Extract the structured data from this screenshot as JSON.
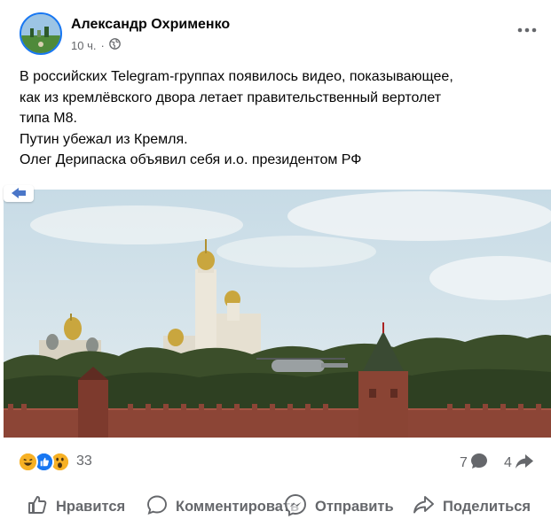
{
  "post": {
    "author": "Александр Охрименко",
    "time": "10 ч.",
    "separator": "·",
    "text_lines": [
      "В российских Telegram-группах появилось видео, показывающее,",
      "как из кремлёвского двора летает правительственный вертолет",
      "типа М8.",
      "Путин убежал из Кремля.",
      "Олег Дерипаска объявил себя и.о. президентом РФ"
    ],
    "image_alt_icon": "video-badge-icon"
  },
  "stats": {
    "reactions": [
      "haha",
      "like",
      "wow"
    ],
    "reaction_count": "33",
    "comment_count": "7",
    "share_count": "4"
  },
  "actions": {
    "like": "Нравится",
    "comment": "Комментировать",
    "send": "Отправить",
    "share": "Поделиться"
  },
  "colors": {
    "brand": "#1877f2",
    "secondary_text": "#65676b",
    "like_blue": "#1877f2",
    "haha_yellow": "#f7b125"
  }
}
